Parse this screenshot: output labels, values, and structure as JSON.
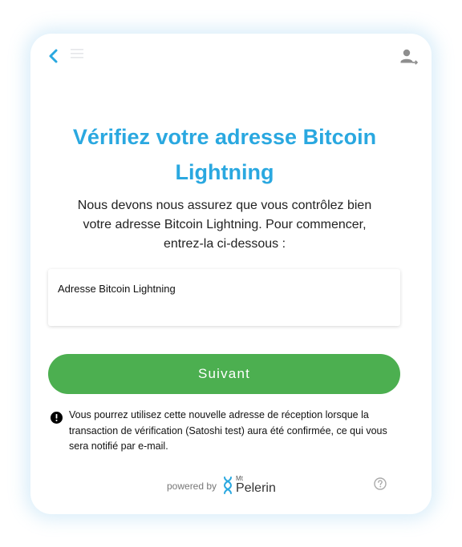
{
  "header": {
    "back_icon": "chevron-left-icon",
    "menu_icon": "menu-icon",
    "account_icon": "user-logout-icon"
  },
  "main": {
    "title": "Vérifiez votre adresse Bitcoin Lightning",
    "subtitle": "Nous devons nous assurez que vous contrôlez bien votre adresse Bitcoin Lightning. Pour commencer, entrez-la ci-dessous :",
    "input": {
      "label": "Adresse Bitcoin Lightning",
      "value": ""
    },
    "next_button_label": "Suivant",
    "notice": {
      "icon": "exclamation-circle-icon",
      "text": "Vous pourrez utilisez cette nouvelle adresse de réception lorsque la transaction de vérification (Satoshi test) aura été confirmée, ce qui vous sera notifié par e-mail."
    }
  },
  "footer": {
    "powered_by": "powered by",
    "brand_prefix": "Mt",
    "brand_name": "Pelerin",
    "help_icon": "question-circle-icon"
  },
  "colors": {
    "accent": "#2aa8e0",
    "button": "#4caf50",
    "card_glow": "#78beeb"
  }
}
